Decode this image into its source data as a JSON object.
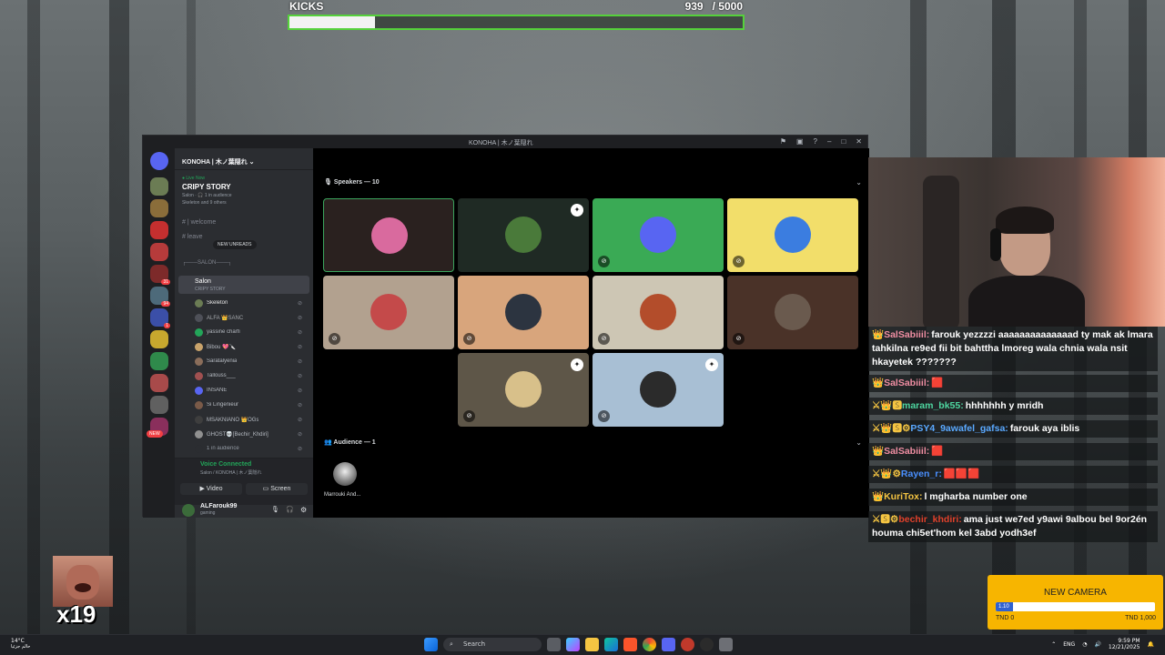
{
  "kicks": {
    "label": "KICKS",
    "current": "939",
    "total": "/ 5000",
    "progress": 0.1878
  },
  "discord": {
    "window_title": "KONOHA | 木ノ葉隠れ",
    "server_name": "KONOHA | 木ノ葉隠れ",
    "live": {
      "tag": "● Live Now",
      "name": "CRIPY STORY",
      "sub1": "Salon · 🎧 1 in audience",
      "sub2": "Skeleton and 9 others"
    },
    "channels": {
      "welcome": "| welcome",
      "leave": "leave",
      "new_unreads": "NEW UNREADS",
      "category": "┌───SALON───┐"
    },
    "salon": {
      "name": "Salon",
      "topic": "CRIPY STORY"
    },
    "members": [
      {
        "name": "Skeleton",
        "color": "#e6e6e6",
        "av": "#6b7c54"
      },
      {
        "name": "ALFA 👑SANC",
        "color": "#a3a6aa",
        "av": "#4e5058"
      },
      {
        "name": "yassine charfi",
        "color": "#b5bac1",
        "av": "#23a559"
      },
      {
        "name": "Bibou 💖🔪",
        "color": "#b5bac1",
        "av": "#c9a36b"
      },
      {
        "name": "Saratalyenia",
        "color": "#b5bac1",
        "av": "#8a6d5a"
      },
      {
        "name": "Tallouss___",
        "color": "#b5bac1",
        "av": "#a05050"
      },
      {
        "name": "INSANE",
        "color": "#b5bac1",
        "av": "#5865f2"
      },
      {
        "name": "Si Lingenieur",
        "color": "#b5bac1",
        "av": "#7a5a48"
      },
      {
        "name": "MSAKNIANO 👑OGs",
        "color": "#b5bac1",
        "av": "#3e3e3e"
      },
      {
        "name": "GHOST💀[Bechir_Khdiri]",
        "color": "#b5bac1",
        "av": "#909090"
      },
      {
        "name": "1 in audience",
        "color": "#949ba4",
        "av": "#2b2d31"
      }
    ],
    "guild_new": "NEW",
    "voice": {
      "status": "Voice Connected",
      "channel": "Salon / KONOHA | 木ノ葉隠れ",
      "video": "Video",
      "screen": "Screen"
    },
    "user": {
      "name": "ALFarouk99",
      "status": "gaming"
    },
    "speakers_header": "Speakers — 10",
    "audience_header": "Audience — 1",
    "audience_name": "Marrouki And...",
    "tiles": [
      {
        "bg": "#2a211f",
        "av": "#d96a9e"
      },
      {
        "bg": "#1f2a24",
        "av": "#4a7a3a"
      },
      {
        "bg": "#3aaa55",
        "av": "#5865f2"
      },
      {
        "bg": "#f2de6a",
        "av": "#3b7de0"
      },
      {
        "bg": "#b2a18f",
        "av": "#c44a4a"
      },
      {
        "bg": "#d8a57c",
        "av": "#2c3440"
      },
      {
        "bg": "#cdc6b4",
        "av": "#b34d2b"
      },
      {
        "bg": "#4a3228",
        "av": "#6a5a4e"
      },
      {
        "bg": "#5e5648",
        "av": "#d8c08a"
      },
      {
        "bg": "#a8bfd4",
        "av": "#2b2b2b"
      }
    ]
  },
  "chat": [
    {
      "user": "SalSabiiil:",
      "color": "#f08ea3",
      "badges": "👑",
      "text": "farouk yezzzzi aaaaaaaaaaaaaad ty mak ak lmara tahkilna re9ed fii bit bahttha lmoreg wala chnia wala nsit hkayetek ???????"
    },
    {
      "user": "SalSabiiil:",
      "color": "#f08ea3",
      "badges": "👑",
      "text": "🟥"
    },
    {
      "user": "maram_bk55:",
      "color": "#4ed6a0",
      "badges": "⚔👑🆂",
      "text": "hhhhhhh y mridh"
    },
    {
      "user": "PSY4_9awafel_gafsa:",
      "color": "#5aa9ff",
      "badges": "⚔👑🆂⚙",
      "text": "farouk aya iblis"
    },
    {
      "user": "SalSabiiil:",
      "color": "#f08ea3",
      "badges": "👑",
      "text": "🟥"
    },
    {
      "user": "Rayen_r:",
      "color": "#4a90ff",
      "badges": "⚔👑⚙",
      "text": "🟥🟥🟥"
    },
    {
      "user": "KuriTox:",
      "color": "#f5c542",
      "badges": "👑",
      "text": "l mgharba number one"
    },
    {
      "user": "bechir_khdiri:",
      "color": "#e0412b",
      "badges": "⚔🆂⚙",
      "text": "ama just we7ed y9awi 9albou bel 9or2én houma chi5et'hom kel 3abd yodh3ef"
    }
  ],
  "goal": {
    "title": "NEW CAMERA",
    "fill_label": "1.10",
    "left": "TND 0",
    "right": "TND 1,000",
    "progress": 0.11
  },
  "meme": {
    "count": "x19"
  },
  "taskbar": {
    "temp": "14°C",
    "weather_sub": "حالم جزئيا",
    "search": "Search",
    "lang": "ENG",
    "time": "9:59 PM",
    "date": "12/21/2025"
  }
}
